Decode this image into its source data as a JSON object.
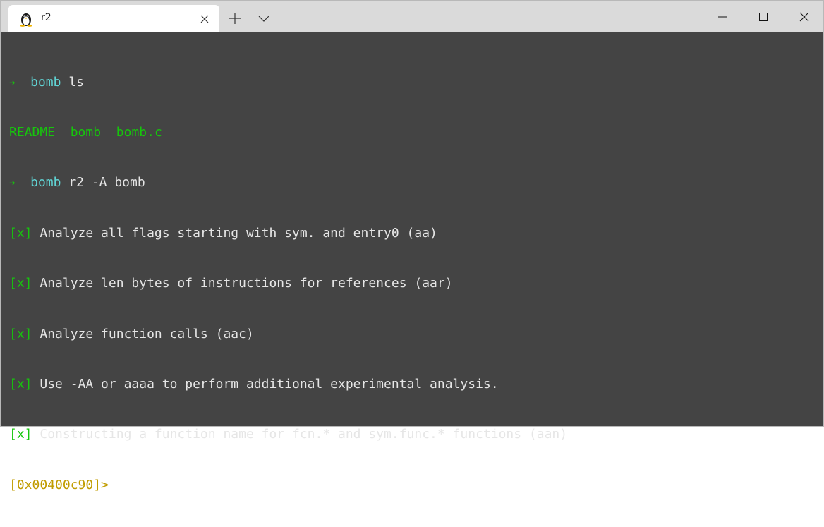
{
  "tab": {
    "title": "r2",
    "icon": "linux-penguin-icon"
  },
  "titlebar": {
    "new_tab_icon": "plus-icon",
    "dropdown_icon": "chevron-down-icon",
    "minimize_icon": "minimize-icon",
    "maximize_icon": "maximize-icon",
    "close_icon": "close-icon"
  },
  "terminal": {
    "colors": {
      "background": "#444444",
      "green": "#16c60c",
      "cyan": "#61d6d6",
      "text": "#e6e6e6",
      "prompt": "#c19c00"
    },
    "line1": {
      "arrow": "➜",
      "dir": "bomb",
      "command": "ls"
    },
    "line2": {
      "file1": "README",
      "file2": "bomb",
      "file3": "bomb.c"
    },
    "line3": {
      "arrow": "➜",
      "dir": "bomb",
      "command": "r2 -A bomb"
    },
    "analysis": [
      {
        "mark": "[x]",
        "text": "Analyze all flags starting with sym. and entry0 (aa)"
      },
      {
        "mark": "[x]",
        "text": "Analyze len bytes of instructions for references (aar)"
      },
      {
        "mark": "[x]",
        "text": "Analyze function calls (aac)"
      },
      {
        "mark": "[x]",
        "text": "Use -AA or aaaa to perform additional experimental analysis."
      },
      {
        "mark": "[x]",
        "text": "Constructing a function name for fcn.* and sym.func.* functions (aan)"
      }
    ],
    "r2_prompt": "[0x00400c90]>"
  }
}
